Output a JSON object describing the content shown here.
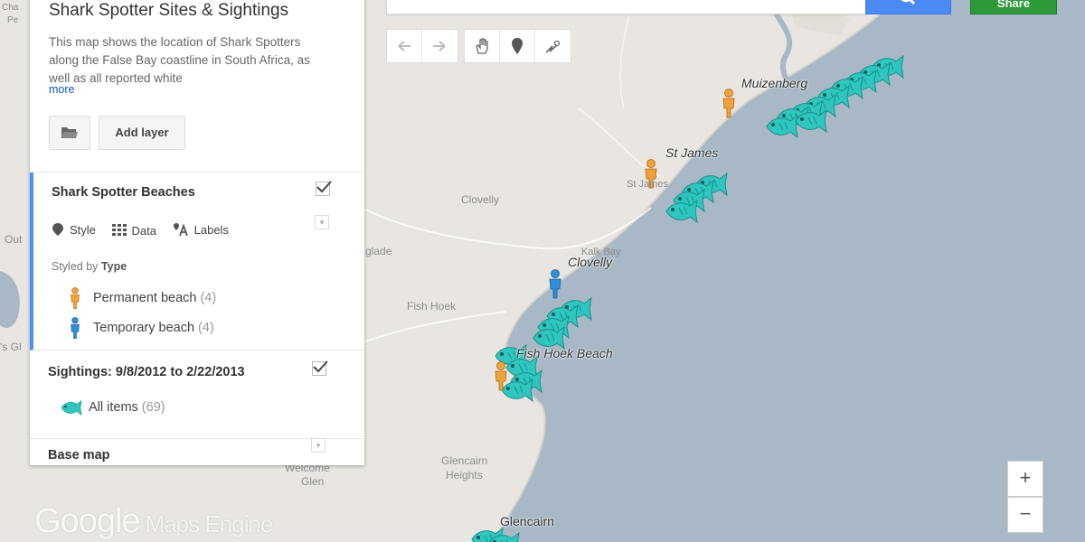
{
  "panel": {
    "title": "Shark Spotter Sites & Sightings",
    "description": "This map shows the location of Shark Spotters along the False Bay coastline in South Africa, as well as all reported white",
    "more_link": "more",
    "add_layer_label": "Add layer",
    "layers": [
      {
        "title": "Shark Spotter Beaches",
        "checked": true,
        "tools": {
          "style": "Style",
          "data": "Data",
          "labels": "Labels"
        },
        "styled_by_prefix": "Styled by",
        "styled_by_field": "Type",
        "legend": [
          {
            "label": "Permanent beach",
            "count": "(4)",
            "icon": "orange-person-icon",
            "color": "#f0a13a"
          },
          {
            "label": "Temporary beach",
            "count": "(4)",
            "icon": "blue-person-icon",
            "color": "#2d8fd6"
          }
        ]
      },
      {
        "title": "Sightings: 9/8/2012 to 2/22/2013",
        "checked": true,
        "legend": [
          {
            "label": "All items",
            "count": "(69)",
            "icon": "fish-icon",
            "color": "#2ec7c0"
          }
        ]
      },
      {
        "title": "Base map"
      }
    ]
  },
  "toolbar": {
    "share_label": "Share",
    "tools": [
      "undo-icon",
      "redo-icon",
      "hand-icon",
      "marker-icon",
      "draw-line-icon"
    ]
  },
  "map": {
    "labels": {
      "muizenberg": "Muizenberg",
      "st_james": "St James",
      "st_james_faded": "St James",
      "clovelly_inland": "Clovelly",
      "kalk_bay": "Kalk Bay",
      "clovelly": "Clovelly",
      "glade": "glade",
      "fish_hoek": "Fish Hoek",
      "fish_hoek_beach": "Fish Hoek Beach",
      "glencairn_heights_1": "Glencairn",
      "glencairn_heights_2": "Heights",
      "glencairn": "Glencairn",
      "welcome_glen_1": "Welcome",
      "welcome_glen_2": "Glen",
      "edge_cha": "Cha",
      "edge_pe": "Pe",
      "edge_out": "Out",
      "edge_s_gl": "'s Gl"
    },
    "zoom_in": "+",
    "zoom_out": "−",
    "logo_google": "Google",
    "logo_sub": "Maps Engine",
    "colors": {
      "land": "#e9e6e1",
      "water": "#a8b8c6",
      "fish": "#2ec7c0",
      "person_orange": "#f0a13a",
      "person_blue": "#2d8fd6"
    }
  }
}
